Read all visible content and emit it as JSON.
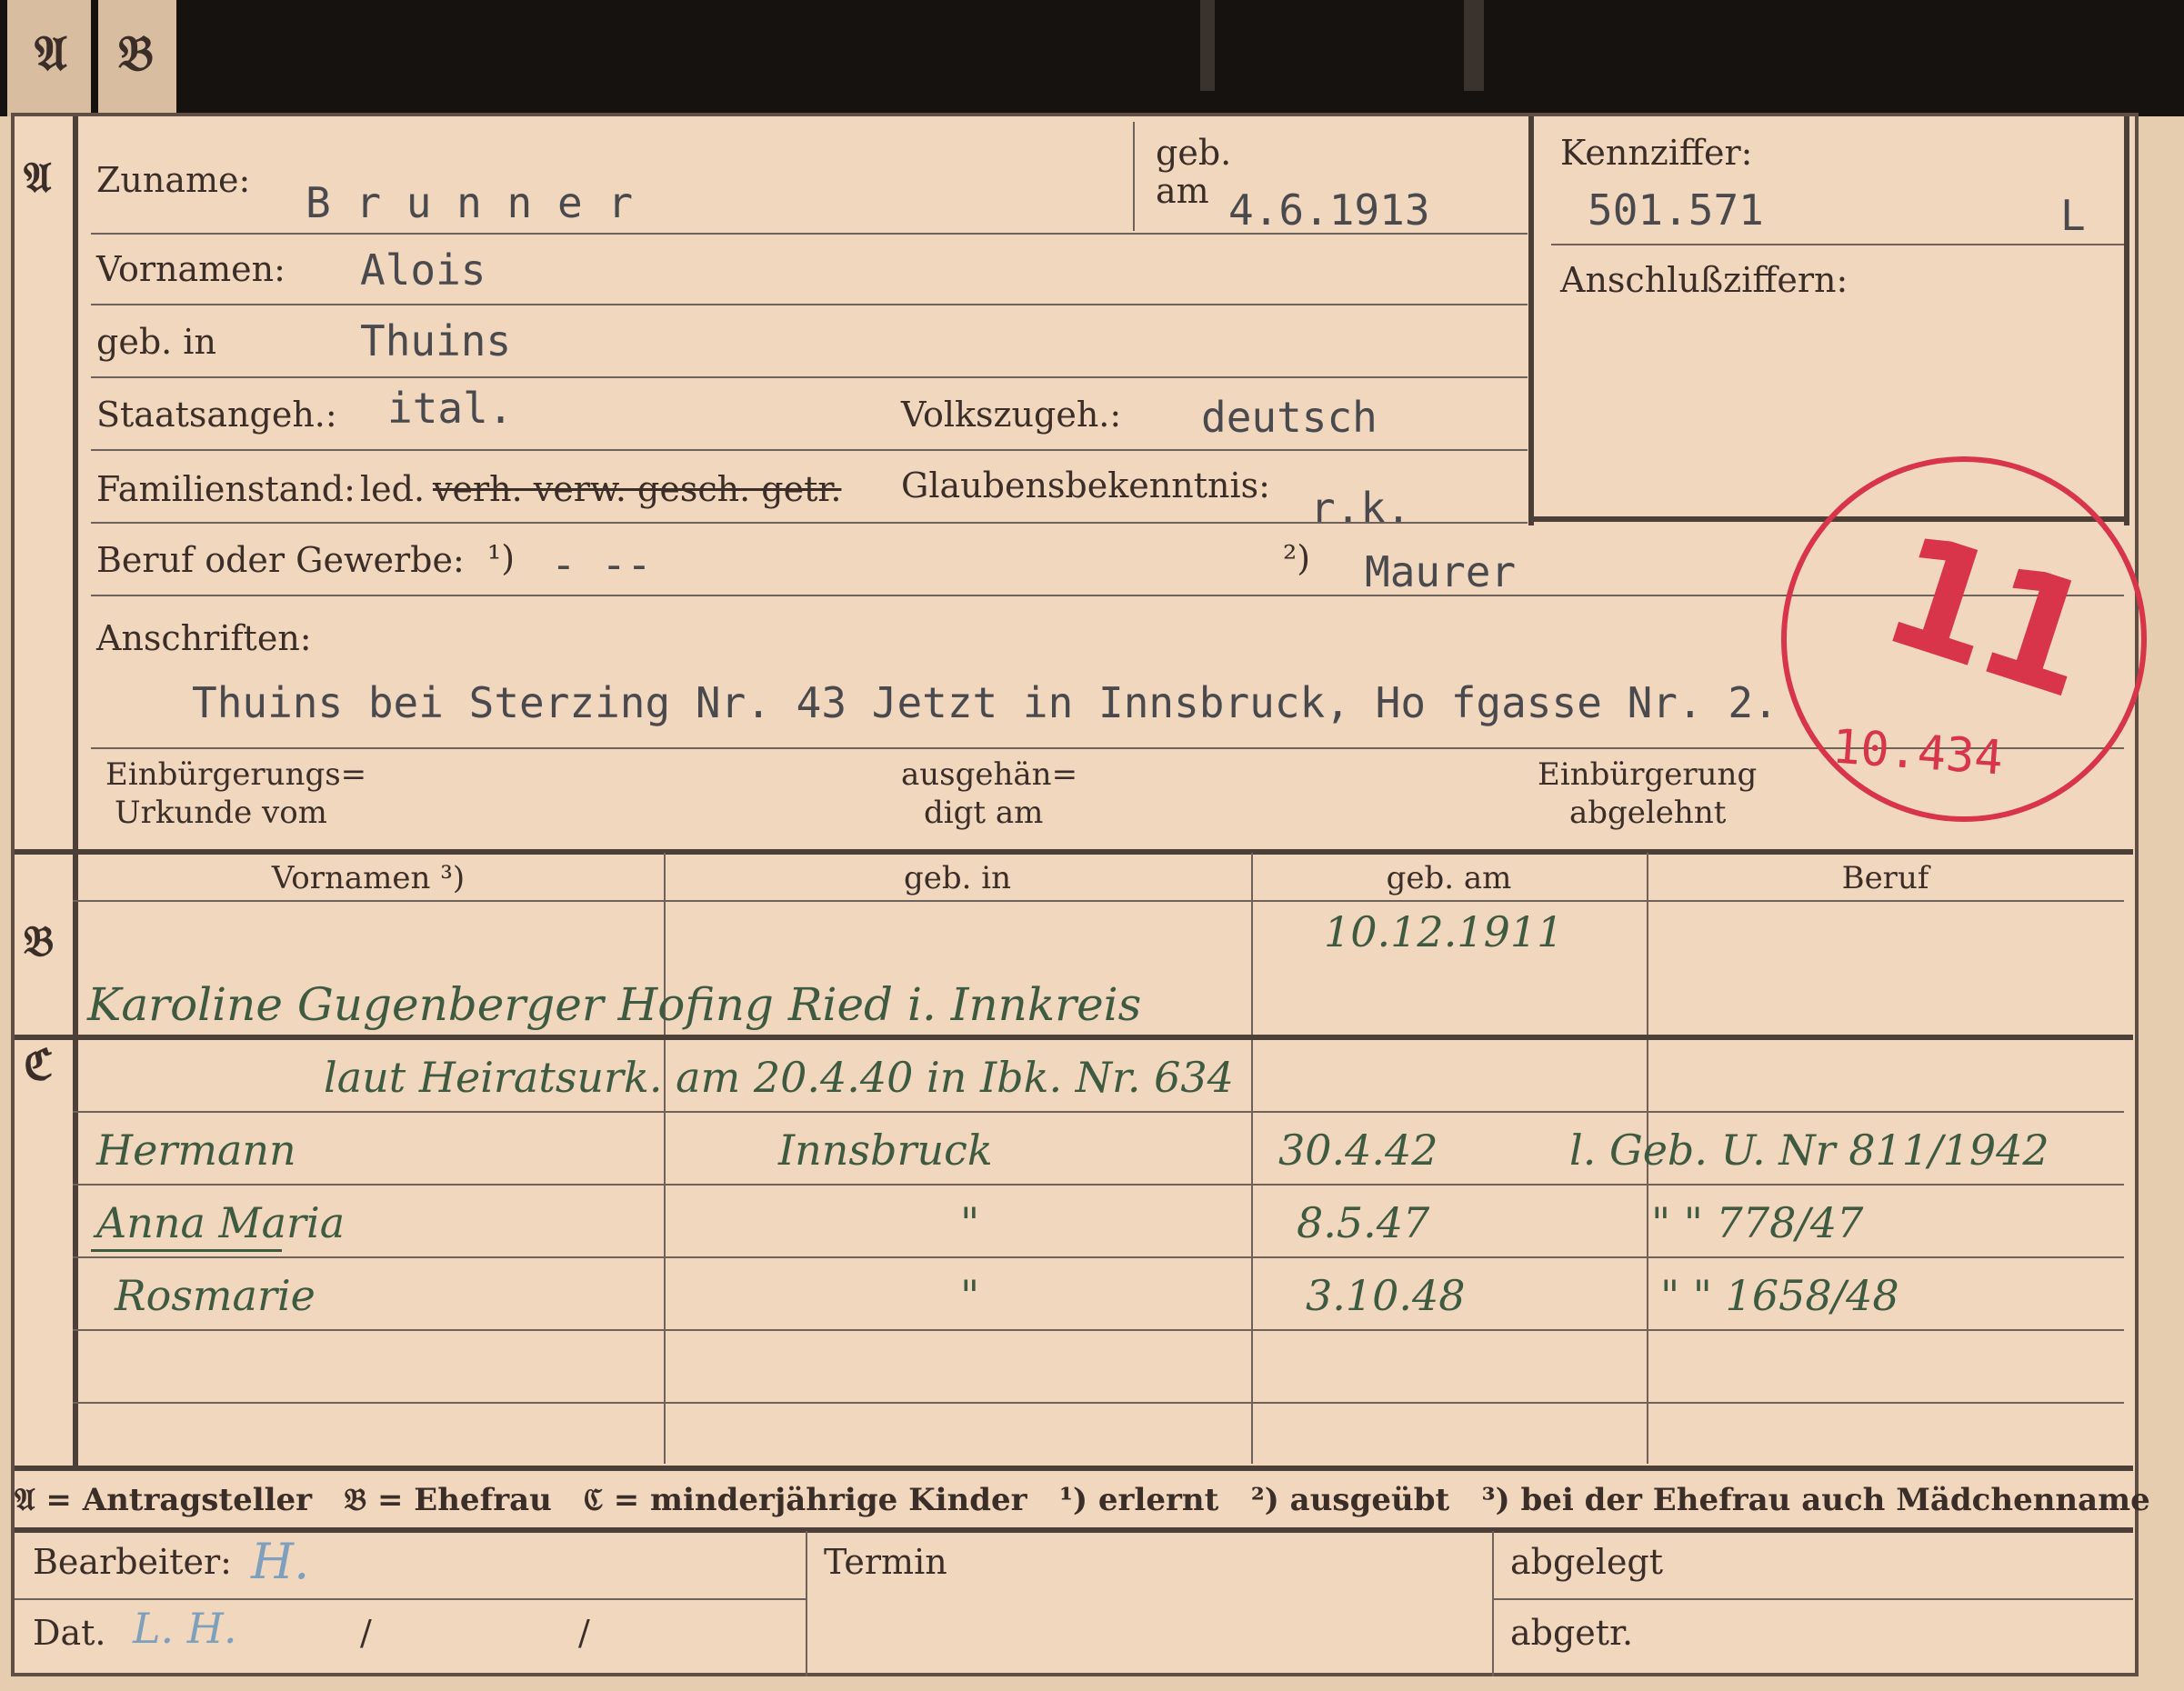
{
  "tabs": {
    "a": "𝔄",
    "b": "𝔅"
  },
  "sections": {
    "a": "𝔄",
    "b": "𝔅",
    "c": "ℭ"
  },
  "labels": {
    "zuname": "Zuname:",
    "geb_am_1": "geb.",
    "geb_am_2": "am",
    "kennziffer": "Kennziffer:",
    "anschlussziffern": "Anschlußziffern:",
    "vornamen": "Vornamen:",
    "geb_in": "geb. in",
    "staatsangeh": "Staatsangeh.:",
    "volkszugeh": "Volkszugeh.:",
    "familienstand": "Familienstand:",
    "familienstand_opts": "led.",
    "familienstand_struck": "verh. verw. gesch. getr.",
    "glaubensbekenntnis": "Glaubensbekenntnis:",
    "beruf": "Beruf oder Gewerbe:",
    "beruf_fn1": "¹)",
    "beruf_fn2": "²)",
    "anschriften": "Anschriften:",
    "einb_urkunde_1": "Einbürgerungs=",
    "einb_urkunde_2": "Urkunde vom",
    "ausgehaendigt_1": "ausgehän=",
    "ausgehaendigt_2": "digt am",
    "einb_abgelehnt_1": "Einbürgerung",
    "einb_abgelehnt_2": "abgelehnt"
  },
  "values": {
    "zuname": "B r u n n e r",
    "geb_am": "4.6.1913",
    "kennziffer": "501.571",
    "kennziffer_suffix": "L",
    "vornamen": "Alois",
    "geb_in": "Thuins",
    "staatsangeh": "ital.",
    "volkszugeh": "deutsch",
    "glaubensbekenntnis": "r.k.",
    "beruf_erlernt": "- --",
    "beruf_ausgeuebt": "Maurer",
    "anschrift": "Thuins bei Sterzing Nr. 43 Jetzt in Innsbruck, Ho fgasse Nr. 2."
  },
  "stamp": {
    "mark": "11",
    "number": "10.434",
    "color": "#d8344a"
  },
  "table_headers": [
    "Vornamen ³)",
    "geb. in",
    "geb. am",
    "Beruf"
  ],
  "table_b": {
    "geb_am": "10.12.1911",
    "entry": "Karoline Gugenberger  Hofing Ried i. Innkreis"
  },
  "table_c": {
    "note": "laut Heiratsurk. am 20.4.40 in Ibk. Nr. 634",
    "rows": [
      {
        "name": "Hermann",
        "place": "Innsbruck",
        "date": "30.4.42",
        "note": "l. Geb. U. Nr 811/1942"
      },
      {
        "name": "Anna Maria",
        "place": "\"",
        "date": "8.5.47",
        "note": "\"  \" 778/47"
      },
      {
        "name": "Rosmarie",
        "place": "\"",
        "date": "3.10.48",
        "note": "\"  \" 1658/48"
      }
    ]
  },
  "legend": "𝔄 = Antragsteller   𝔅 = Ehefrau   ℭ = minderjährige Kinder   ¹) erlernt   ²) ausgeübt   ³) bei der Ehefrau auch Mädchenname",
  "footer": {
    "bearbeiter": "Bearbeiter:",
    "dat": "Dat.",
    "dat_slash1": "/",
    "dat_slash2": "/",
    "termin": "Termin",
    "abgelegt": "abgelegt",
    "abgetr": "abgetr.",
    "bearbeiter_sign": "H.",
    "dat_sign": "L. H."
  },
  "colors": {
    "paper": "#f0d7bd",
    "ink_typed": "#4a4a4e",
    "ink_hand": "#3e5a40",
    "stamp": "#d8344a",
    "background": "#161210"
  }
}
